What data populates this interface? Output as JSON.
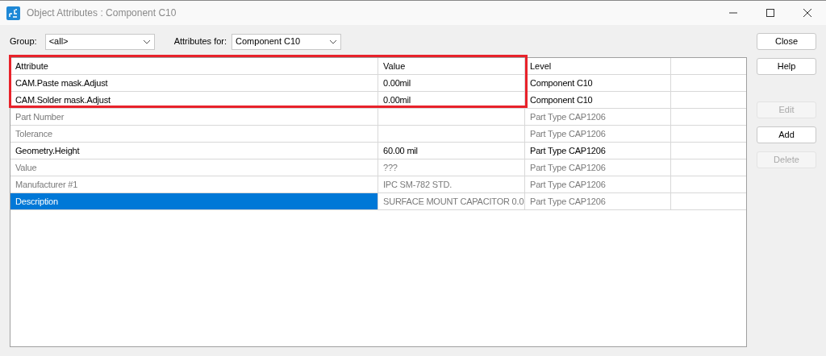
{
  "window": {
    "title": "Object Attributes : Component C10"
  },
  "filters": [
    {
      "label": "Group:",
      "value": "<all>"
    },
    {
      "label": "Attributes for:",
      "value": "Component C10"
    }
  ],
  "table": {
    "columns": [
      "Attribute",
      "Value",
      "Level"
    ],
    "rows": [
      {
        "attribute": "CAM.Paste mask.Adjust",
        "value": "0.00mil",
        "level": "Component C10",
        "inherited": false,
        "selected": false
      },
      {
        "attribute": "CAM.Solder mask.Adjust",
        "value": "0.00mil",
        "level": "Component C10",
        "inherited": false,
        "selected": false
      },
      {
        "attribute": "Part Number",
        "level": "Part Type CAP1206",
        "inherited": true,
        "selected": false
      },
      {
        "attribute": "Tolerance",
        "level": "Part Type CAP1206",
        "inherited": true,
        "selected": false
      },
      {
        "attribute": "Geometry.Height",
        "value": "60.00 mil",
        "level": "Part Type CAP1206",
        "inherited": false,
        "selected": false
      },
      {
        "attribute": "Value",
        "value": "???",
        "level": "Part Type CAP1206",
        "inherited": true,
        "selected": false
      },
      {
        "attribute": "Manufacturer #1",
        "value": "IPC SM-782 STD.",
        "level": "Part Type CAP1206",
        "inherited": true,
        "selected": false
      },
      {
        "attribute": "Description",
        "value": "SURFACE MOUNT CAPACITOR 0.0",
        "level": "Part Type CAP1206",
        "inherited": true,
        "selected": true
      }
    ]
  },
  "buttons": [
    {
      "label": "Close",
      "disabled": false
    },
    {
      "label": "Help",
      "disabled": false
    },
    {
      "label": "Edit",
      "disabled": true
    },
    {
      "label": "Add",
      "disabled": false
    },
    {
      "label": "Delete",
      "disabled": true
    }
  ]
}
